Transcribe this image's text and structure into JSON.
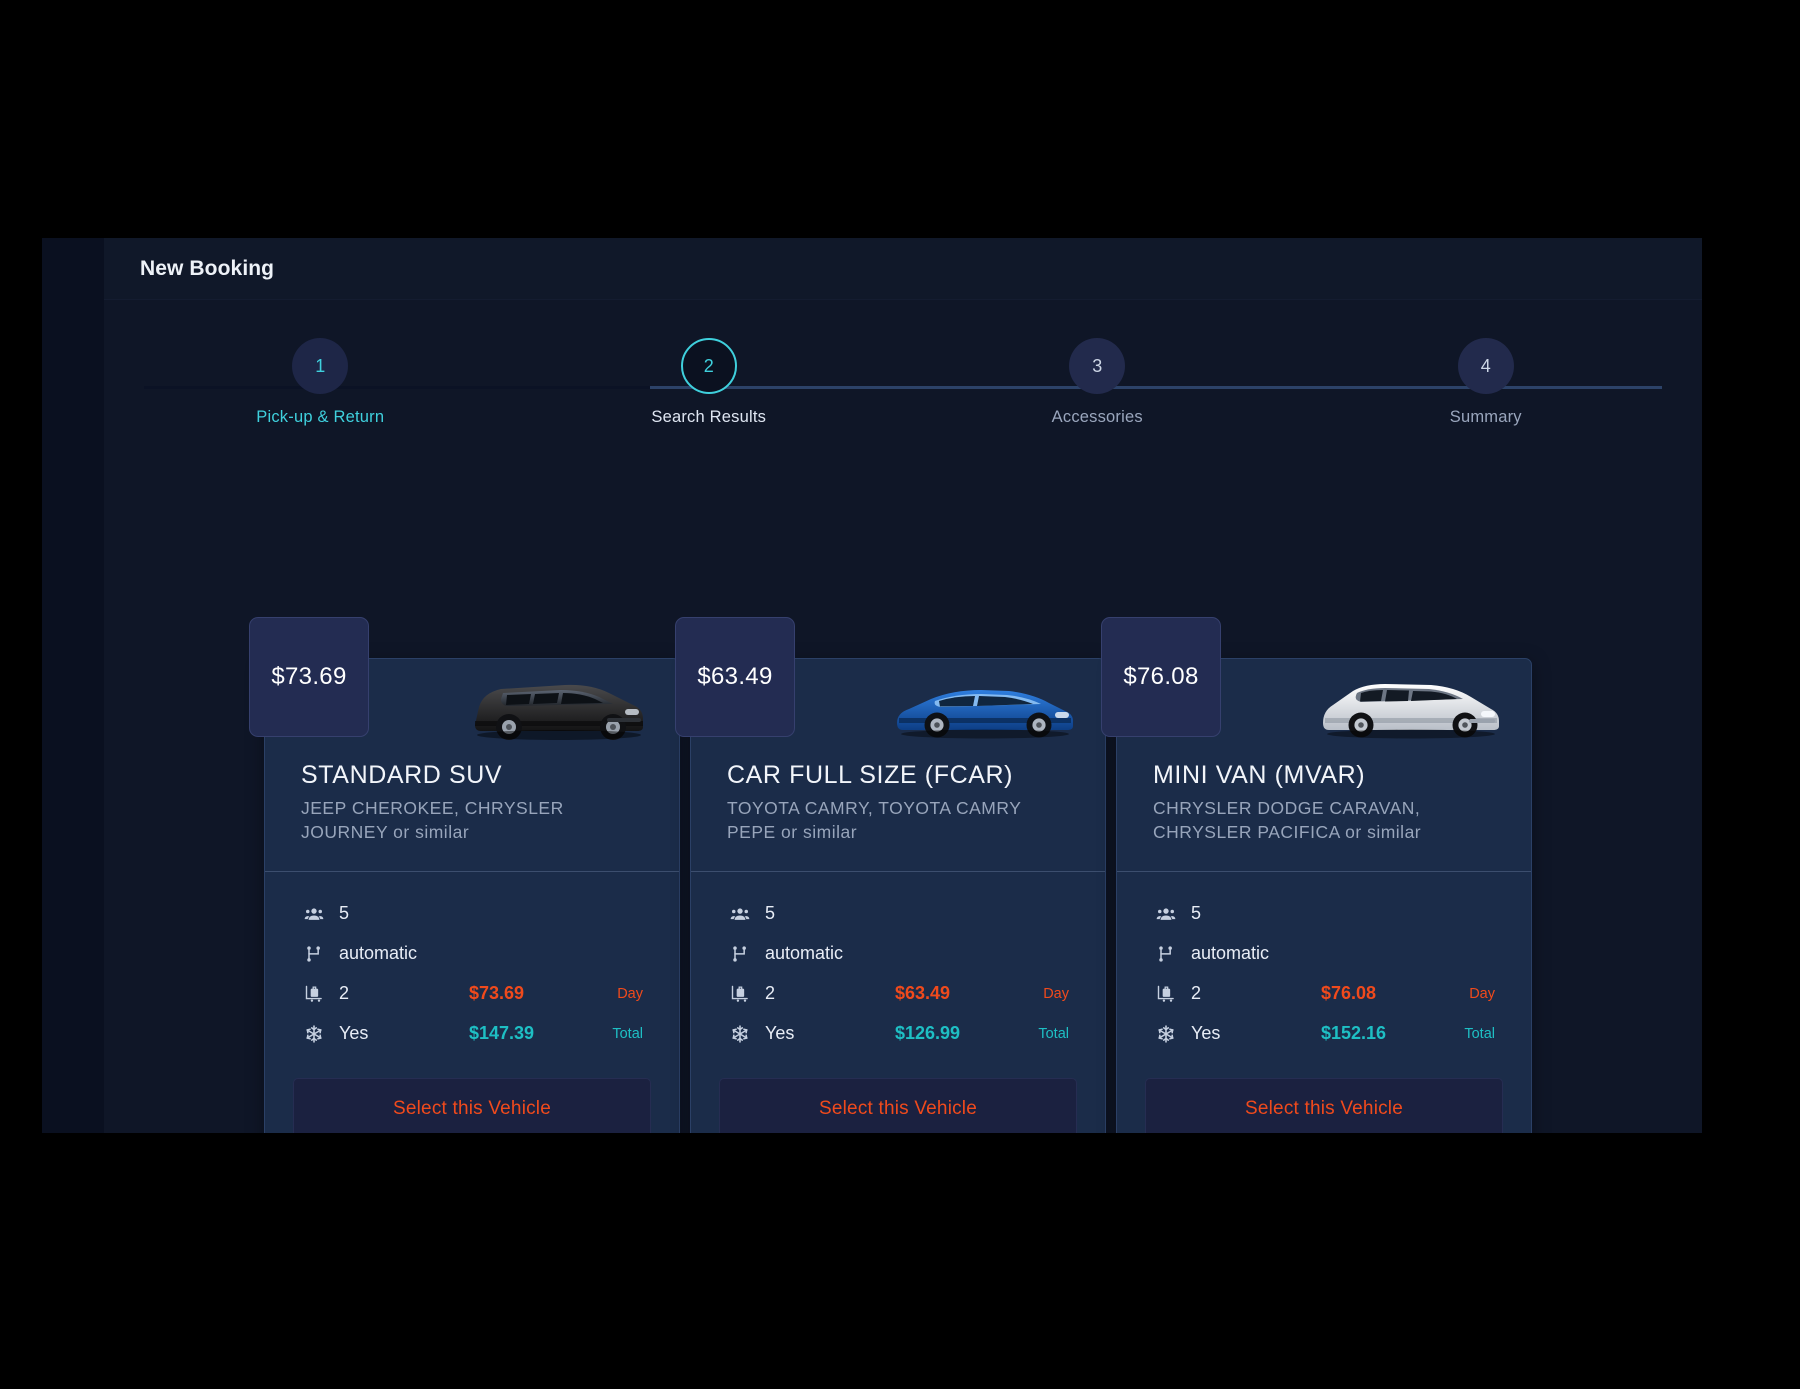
{
  "app": {
    "title": "New Booking"
  },
  "stepper": {
    "steps": [
      {
        "number": "1",
        "label": "Pick-up & Return",
        "state": "done"
      },
      {
        "number": "2",
        "label": "Search Results",
        "state": "current"
      },
      {
        "number": "3",
        "label": "Accessories",
        "state": "todo"
      },
      {
        "number": "4",
        "label": "Summary",
        "state": "todo"
      }
    ]
  },
  "colors": {
    "accent_cyan": "#3fd0dd",
    "accent_orange": "#f04a1c",
    "accent_total": "#1ebfc4",
    "card_bg": "#1b2c49",
    "page_bg": "#0f1627"
  },
  "labels": {
    "day": "Day",
    "total": "Total",
    "select_button": "Select this Vehicle"
  },
  "vehicles": [
    {
      "price_badge": "$73.69",
      "title": "STANDARD SUV",
      "subtitle": "JEEP CHEROKEE, CHRYSLER JOURNEY or similar",
      "image_name": "black-suv-photo",
      "passengers": "5",
      "transmission": "automatic",
      "luggage": "2",
      "air_conditioning": "Yes",
      "price_day": "$73.69",
      "price_total": "$147.39",
      "day_label": "Day",
      "total_label": "Total",
      "button": "Select this Vehicle"
    },
    {
      "price_badge": "$63.49",
      "title": "CAR FULL SIZE (FCAR)",
      "subtitle": "TOYOTA CAMRY, TOYOTA CAMRY PEPE or similar",
      "image_name": "blue-sedan-photo",
      "passengers": "5",
      "transmission": "automatic",
      "luggage": "2",
      "air_conditioning": "Yes",
      "price_day": "$63.49",
      "price_total": "$126.99",
      "day_label": "Day",
      "total_label": "Total",
      "button": "Select this Vehicle"
    },
    {
      "price_badge": "$76.08",
      "title": "MINI VAN (MVAR)",
      "subtitle": "CHRYSLER DODGE CARAVAN, CHRYSLER PACIFICA or similar",
      "image_name": "white-minivan-photo",
      "passengers": "5",
      "transmission": "automatic",
      "luggage": "2",
      "air_conditioning": "Yes",
      "price_day": "$76.08",
      "price_total": "$152.16",
      "day_label": "Day",
      "total_label": "Total",
      "button": "Select this Vehicle"
    }
  ]
}
